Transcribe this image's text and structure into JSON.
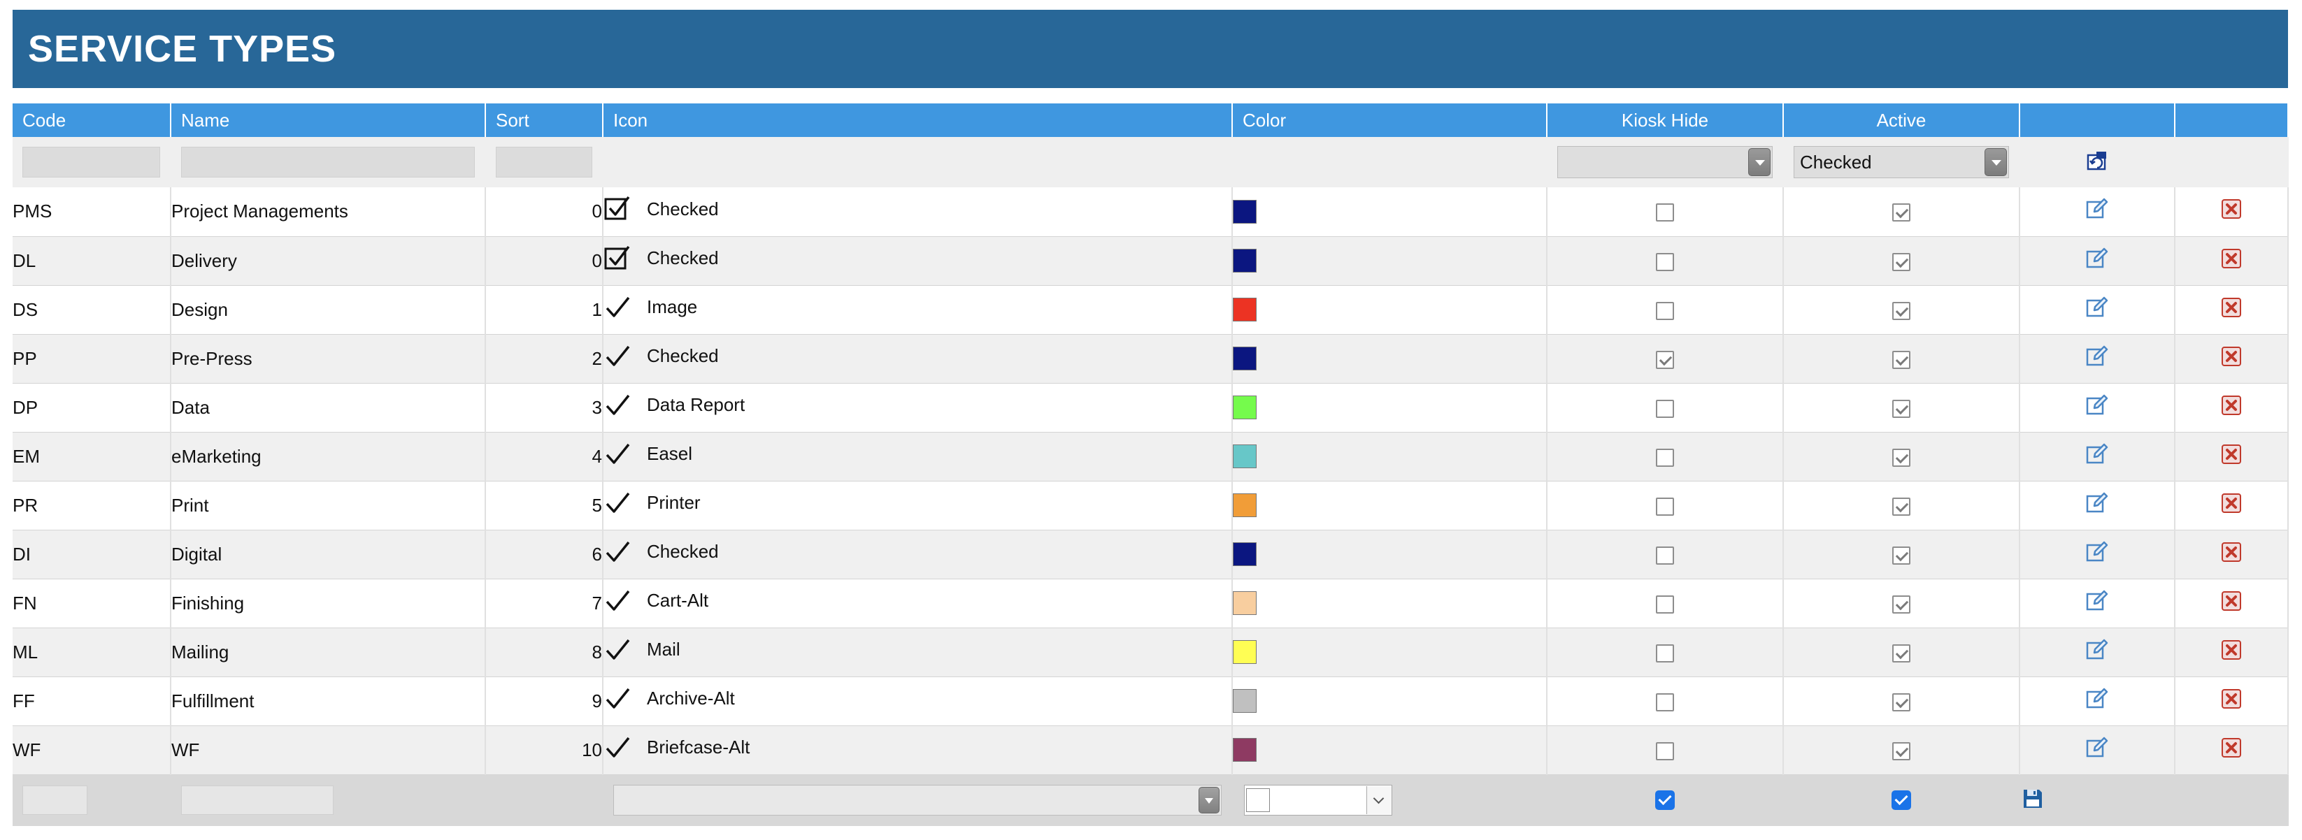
{
  "page": {
    "title": "SERVICE TYPES"
  },
  "columns": {
    "code": "Code",
    "name": "Name",
    "sort": "Sort",
    "icon": "Icon",
    "color": "Color",
    "kiosk_hide": "Kiosk Hide",
    "active": "Active"
  },
  "filters": {
    "code_value": "",
    "name_value": "",
    "sort_value": "",
    "kiosk_hide_value": "",
    "active_value": "Checked",
    "refresh_icon": "refresh-filter-icon"
  },
  "rows": [
    {
      "code": "PMS",
      "name": "Project Managements",
      "sort": "0",
      "icon": "check-square-icon",
      "icon_label": "Checked",
      "color": "#0b1680",
      "kiosk_hide": false,
      "active": true
    },
    {
      "code": "DL",
      "name": "Delivery",
      "sort": "0",
      "icon": "check-square-icon",
      "icon_label": "Checked",
      "color": "#0b1680",
      "kiosk_hide": false,
      "active": true
    },
    {
      "code": "DS",
      "name": "Design",
      "sort": "1",
      "icon": "check-icon",
      "icon_label": "Image",
      "color": "#ec3323",
      "kiosk_hide": false,
      "active": true
    },
    {
      "code": "PP",
      "name": "Pre-Press",
      "sort": "2",
      "icon": "check-icon",
      "icon_label": "Checked",
      "color": "#0b1680",
      "kiosk_hide": true,
      "active": true
    },
    {
      "code": "DP",
      "name": "Data",
      "sort": "3",
      "icon": "check-icon",
      "icon_label": "Data Report",
      "color": "#75fb4c",
      "kiosk_hide": false,
      "active": true
    },
    {
      "code": "EM",
      "name": "eMarketing",
      "sort": "4",
      "icon": "check-icon",
      "icon_label": "Easel",
      "color": "#67c7c8",
      "kiosk_hide": false,
      "active": true
    },
    {
      "code": "PR",
      "name": "Print",
      "sort": "5",
      "icon": "check-icon",
      "icon_label": "Printer",
      "color": "#f19d38",
      "kiosk_hide": false,
      "active": true
    },
    {
      "code": "DI",
      "name": "Digital",
      "sort": "6",
      "icon": "check-icon",
      "icon_label": "Checked",
      "color": "#0b1680",
      "kiosk_hide": false,
      "active": true
    },
    {
      "code": "FN",
      "name": "Finishing",
      "sort": "7",
      "icon": "check-icon",
      "icon_label": "Cart-Alt",
      "color": "#f8ce9f",
      "kiosk_hide": false,
      "active": true
    },
    {
      "code": "ML",
      "name": "Mailing",
      "sort": "8",
      "icon": "check-icon",
      "icon_label": "Mail",
      "color": "#fffe54",
      "kiosk_hide": false,
      "active": true
    },
    {
      "code": "FF",
      "name": "Fulfillment",
      "sort": "9",
      "icon": "check-icon",
      "icon_label": "Archive-Alt",
      "color": "#c0c0c0",
      "kiosk_hide": false,
      "active": true
    },
    {
      "code": "WF",
      "name": "WF",
      "sort": "10",
      "icon": "check-icon",
      "icon_label": "Briefcase-Alt",
      "color": "#8e3a62",
      "kiosk_hide": false,
      "active": true
    }
  ],
  "row_actions": {
    "edit_icon": "edit-icon",
    "delete_icon": "delete-icon"
  },
  "new_row": {
    "code_value": "",
    "name_value": "",
    "icon_value": "",
    "color_value": "",
    "kiosk_hide": true,
    "active": true,
    "save_icon": "save-icon"
  },
  "theme": {
    "header_bg": "#286798",
    "column_header_bg": "#3f97e0",
    "edit_icon_color": "#4a86c5",
    "delete_icon_color": "#c0392b",
    "save_icon_color": "#1f5fa0"
  }
}
